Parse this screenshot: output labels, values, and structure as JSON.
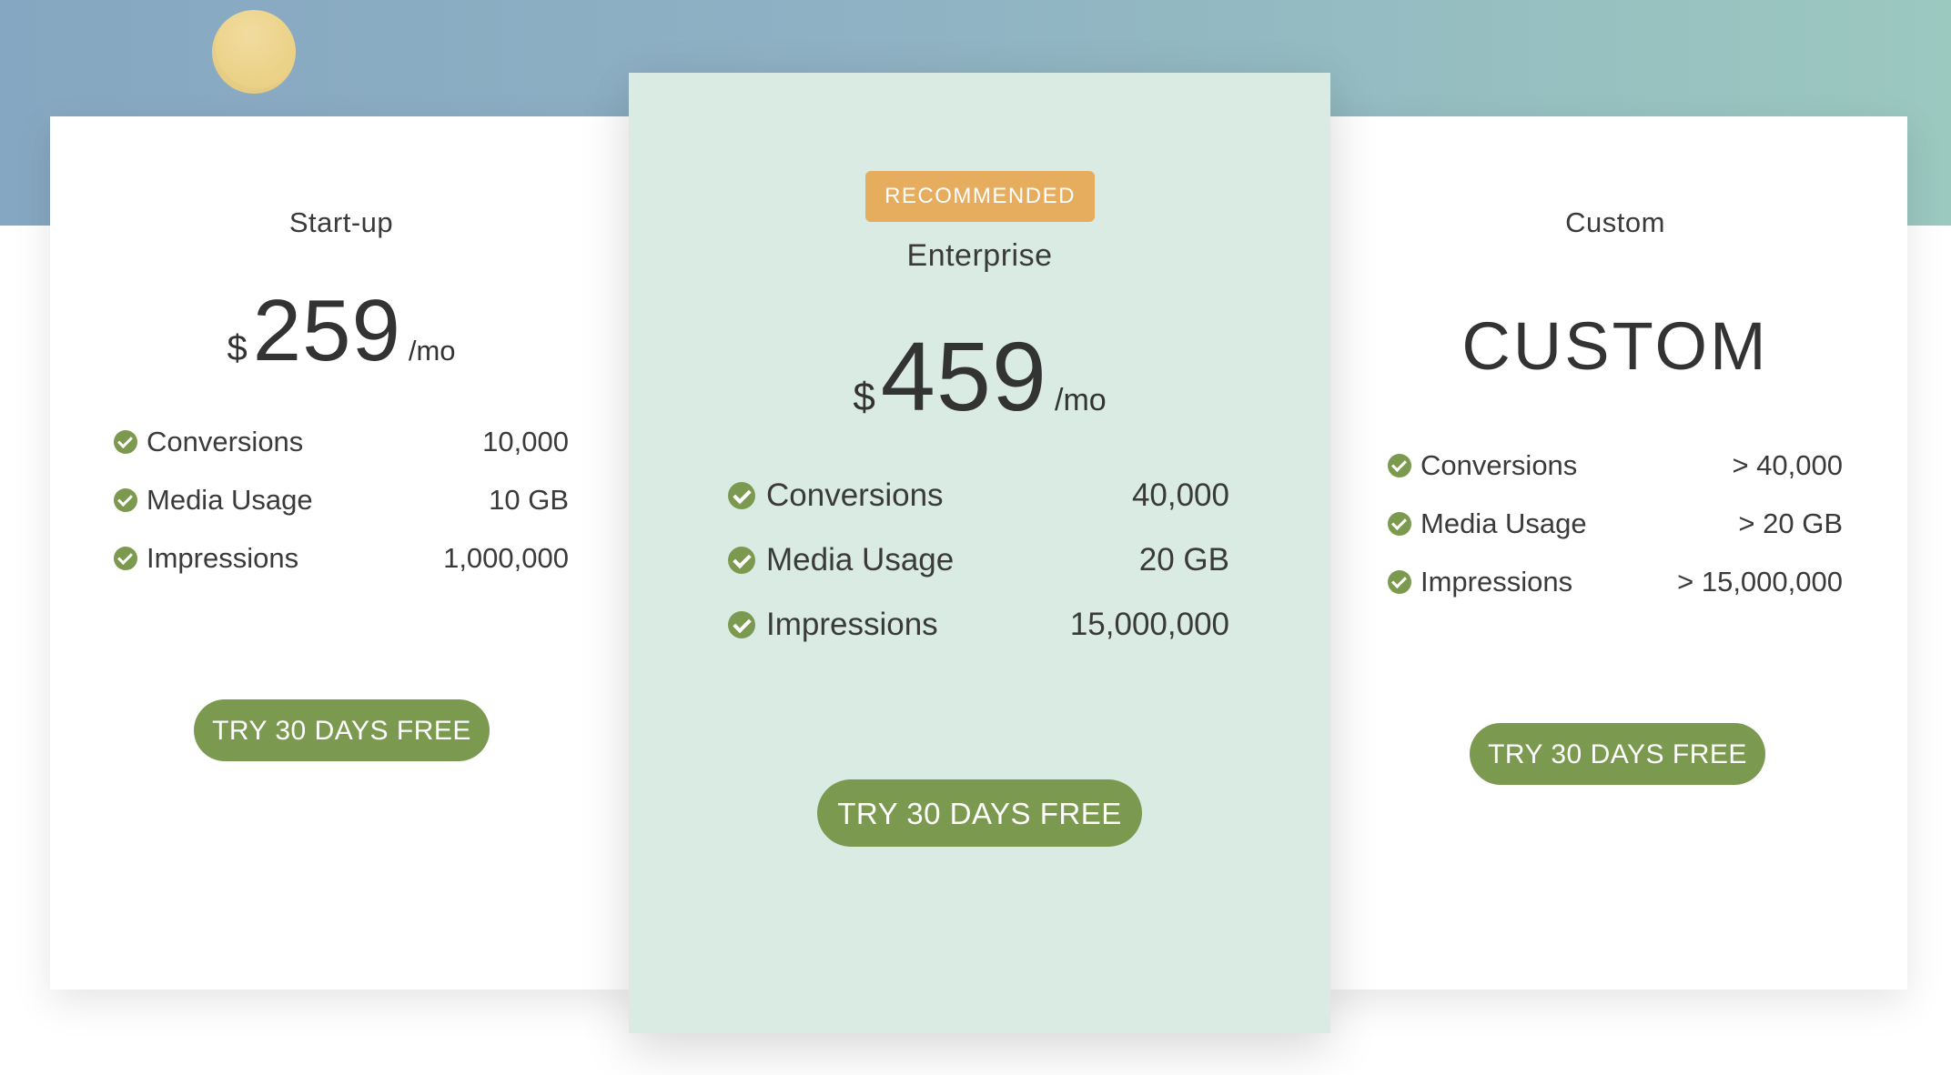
{
  "plans": {
    "startup": {
      "name": "Start-up",
      "currency": "$",
      "amount": "259",
      "period": "/mo",
      "features": [
        {
          "label": "Conversions",
          "value": "10,000"
        },
        {
          "label": "Media Usage",
          "value": "10 GB"
        },
        {
          "label": "Impressions",
          "value": "1,000,000"
        }
      ],
      "cta_label": "TRY 30 DAYS FREE"
    },
    "enterprise": {
      "badge": "RECOMMENDED",
      "name": "Enterprise",
      "currency": "$",
      "amount": "459",
      "period": "/mo",
      "features": [
        {
          "label": "Conversions",
          "value": "40,000"
        },
        {
          "label": "Media Usage",
          "value": "20 GB"
        },
        {
          "label": "Impressions",
          "value": "15,000,000"
        }
      ],
      "cta_label": "TRY 30 DAYS FREE"
    },
    "custom": {
      "name": "Custom",
      "price_text": "CUSTOM",
      "features": [
        {
          "label": "Conversions",
          "value": "> 40,000"
        },
        {
          "label": "Media Usage",
          "value": "> 20 GB"
        },
        {
          "label": "Impressions",
          "value": "> 15,000,000"
        }
      ],
      "cta_label": "TRY 30 DAYS FREE"
    }
  },
  "colors": {
    "accent_green": "#7b9a50",
    "badge_orange": "#e7ad5f",
    "featured_card_bg": "#d9ebe3",
    "hero_blue": "#86a7c1",
    "hero_teal": "#9bc8bf",
    "sun_yellow": "#ecd38a"
  }
}
